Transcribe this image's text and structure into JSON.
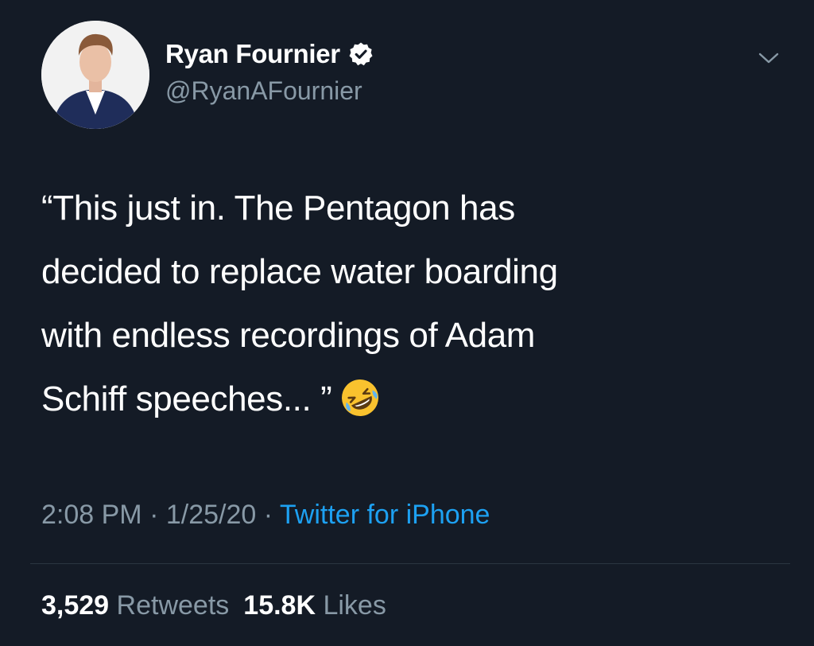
{
  "author": {
    "display_name": "Ryan Fournier",
    "handle": "@RyanAFournier",
    "verified": true,
    "avatar": "profile-photo"
  },
  "tweet": {
    "text_lines": [
      "“This just in. The Pentagon has",
      "decided to replace water boarding",
      "with endless recordings of Adam",
      "Schiff speeches... ”"
    ],
    "emoji": "rolling-on-the-floor-laughing-emoji"
  },
  "meta": {
    "time": "2:08 PM",
    "separator1": " · ",
    "date": "1/25/20",
    "separator2": " · ",
    "source": "Twitter for iPhone"
  },
  "stats": {
    "retweets_count": "3,529",
    "retweets_label": "Retweets",
    "likes_count": "15.8K",
    "likes_label": "Likes"
  },
  "icons": {
    "caret": "chevron-down-icon",
    "verified": "verified-badge-icon"
  },
  "colors": {
    "background": "#141b26",
    "secondary_text": "#8899a6",
    "link": "#1da1f2",
    "divider": "#2b3640"
  }
}
